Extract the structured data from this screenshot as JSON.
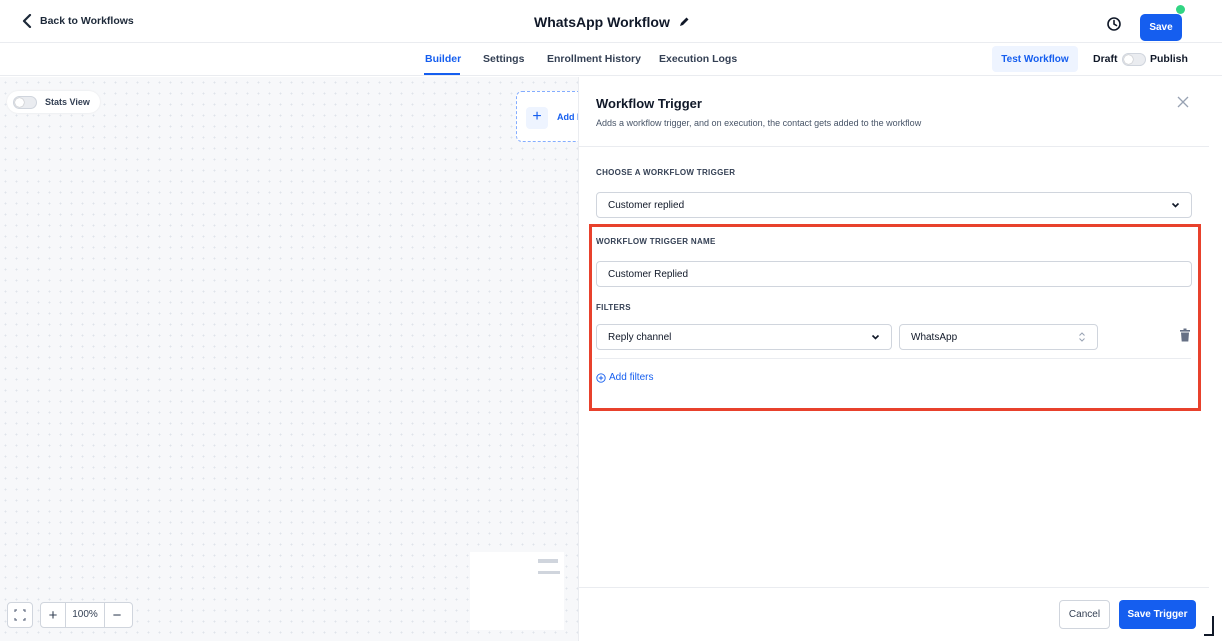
{
  "header": {
    "back_label": "Back to Workflows",
    "title": "WhatsApp Workflow",
    "save_label": "Save",
    "status_dot_color": "#32d583"
  },
  "tabs": [
    {
      "label": "Builder",
      "active": true
    },
    {
      "label": "Settings",
      "active": false
    },
    {
      "label": "Enrollment History",
      "active": false
    },
    {
      "label": "Execution Logs",
      "active": false
    }
  ],
  "toolbar": {
    "test_label": "Test Workflow",
    "draft_label": "Draft",
    "publish_label": "Publish",
    "publish_on": false
  },
  "canvas": {
    "stats_label": "Stats View",
    "stats_on": false,
    "add_node_label": "Add N",
    "zoom_value": "100%"
  },
  "panel": {
    "title": "Workflow Trigger",
    "description": "Adds a workflow trigger, and on execution, the contact gets added to the workflow",
    "choose_label": "CHOOSE A WORKFLOW TRIGGER",
    "trigger_selected": "Customer replied",
    "name_label": "WORKFLOW TRIGGER NAME",
    "name_value": "Customer Replied",
    "filters_label": "FILTERS",
    "filter_field": "Reply channel",
    "filter_value": "WhatsApp",
    "add_filters_label": "Add filters",
    "cancel_label": "Cancel",
    "save_trigger_label": "Save Trigger"
  },
  "colors": {
    "accent": "#155eef",
    "highlight": "#e8412c"
  }
}
